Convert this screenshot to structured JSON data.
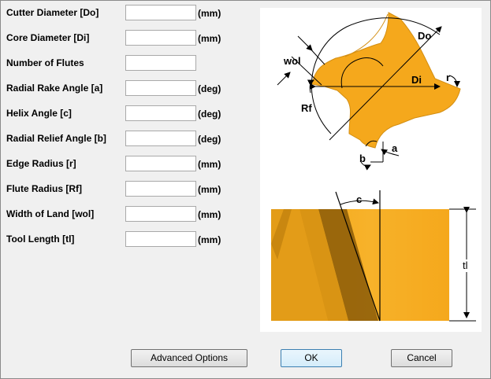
{
  "form": {
    "fields": [
      {
        "label": "Cutter Diameter [Do]",
        "value": "",
        "unit": "(mm)"
      },
      {
        "label": "Core Diameter [Di]",
        "value": "",
        "unit": "(mm)"
      },
      {
        "label": "Number of Flutes",
        "value": "",
        "unit": ""
      },
      {
        "label": "Radial Rake Angle [a]",
        "value": "",
        "unit": "(deg)"
      },
      {
        "label": "Helix Angle [c]",
        "value": "",
        "unit": "(deg)"
      },
      {
        "label": "Radial Relief Angle [b]",
        "value": "",
        "unit": "(deg)"
      },
      {
        "label": "Edge Radius [r]",
        "value": "",
        "unit": "(mm)"
      },
      {
        "label": "Flute Radius [Rf]",
        "value": "",
        "unit": "(mm)"
      },
      {
        "label": "Width of Land [wol]",
        "value": "",
        "unit": "(mm)"
      },
      {
        "label": "Tool Length [tl]",
        "value": "",
        "unit": "(mm)"
      }
    ]
  },
  "diagram": {
    "labels": {
      "wol": "wol",
      "Do": "Do",
      "Di": "Di",
      "r": "r",
      "Rf": "Rf",
      "a": "a",
      "b": "b",
      "c": "c",
      "tl": "tl"
    },
    "colors": {
      "tool": "#f5a81c",
      "tool_dark": "#c98610",
      "line": "#000000"
    }
  },
  "buttons": {
    "advanced": "Advanced Options",
    "ok": "OK",
    "cancel": "Cancel"
  }
}
